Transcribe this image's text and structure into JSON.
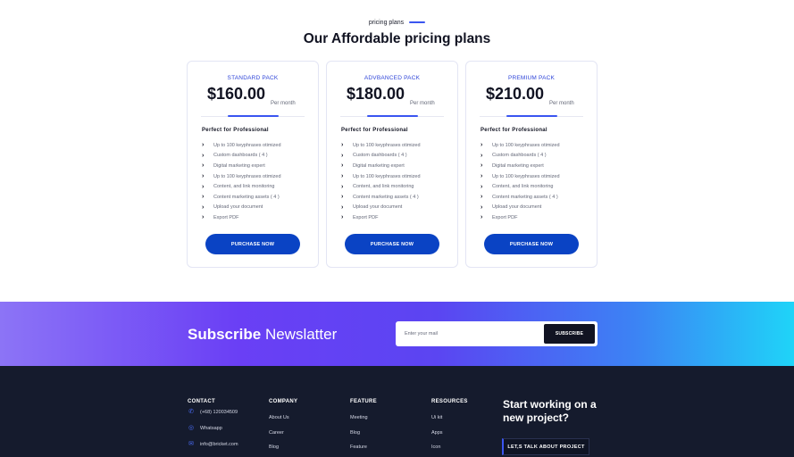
{
  "pricing": {
    "eyebrow": "pricing plans",
    "heading": "Our Affordable pricing plans",
    "plans": [
      {
        "name": "STANDARD PACK",
        "price": "$160.00",
        "period": "Per month",
        "subtitle": "Perfect for Professional",
        "features": [
          "Up to 100 keyphrases otimized",
          "Custom dashboards ( 4 )",
          "Digital marketing expert",
          "Up to 100 keyphrases otimized",
          "Content, and link monitoring",
          "Content marketing assets ( 4 )",
          "Upload your document",
          "Export PDF"
        ],
        "button": "PURCHASE NOW"
      },
      {
        "name": "ADVBANCED PACK",
        "price": "$180.00",
        "period": "Per month",
        "subtitle": "Perfect for Professional",
        "features": [
          "Up to 100 keyphrases otimized",
          "Custom dashboards ( 4 )",
          "Digital marketing expert",
          "Up to 100 keyphrases otimized",
          "Content, and link monitoring",
          "Content marketing assets ( 4 )",
          "Upload your document",
          "Export PDF"
        ],
        "button": "PURCHASE NOW"
      },
      {
        "name": "PREMIUM PACK",
        "price": "$210.00",
        "period": "Per month",
        "subtitle": "Perfect for Professional",
        "features": [
          "Up to 100 keyphrases otimized",
          "Custom dashboards ( 4 )",
          "Digital marketing expert",
          "Up to 100 keyphrases otimized",
          "Content, and link monitoring",
          "Content marketing assets ( 4 )",
          "Upload your document",
          "Export PDF"
        ],
        "button": "PURCHASE NOW"
      }
    ]
  },
  "newsletter": {
    "title_bold": "Subscribe",
    "title_light": "Newslatter",
    "placeholder": "Enter your mail",
    "button": "SUBSCRIBE"
  },
  "footer": {
    "contact": {
      "heading": "CONTACT",
      "phone": "(+68) 120034509",
      "whatsapp": "Whatsapp",
      "email": "info@bricket.com"
    },
    "company": {
      "heading": "COMPANY",
      "links": [
        "About Us",
        "Career",
        "Blog"
      ]
    },
    "feature": {
      "heading": "FEATURE",
      "links": [
        "Meeting",
        "Blog",
        "Feature"
      ]
    },
    "resources": {
      "heading": "RESOURCES",
      "links": [
        "Ui kit",
        "Apps",
        "Icon"
      ]
    },
    "cta_title": "Start working on a new project?",
    "cta_button": "LET,S TALK ABOUT PROJECT"
  },
  "colors": {
    "accent": "#3a55f0",
    "button": "#0a43c4",
    "footer_bg": "#151b2d"
  }
}
